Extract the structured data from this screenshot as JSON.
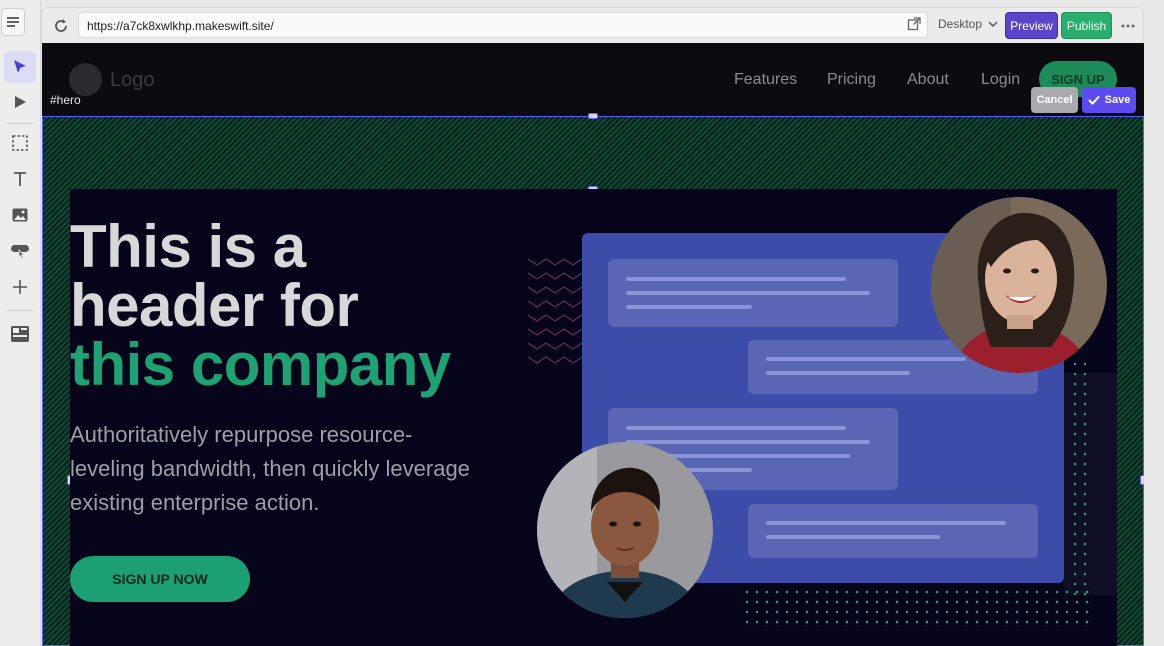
{
  "browser": {
    "url": "https://a7ck8xwlkhp.makeswift.site/",
    "device": "Desktop",
    "preview_label": "Preview",
    "publish_label": "Publish"
  },
  "tools": [
    "select-tool",
    "play-tool",
    "box-tool",
    "text-tool",
    "image-tool",
    "button-tool",
    "add-tool",
    "component-tool"
  ],
  "site": {
    "logo_text": "Logo",
    "nav": [
      {
        "label": "Features"
      },
      {
        "label": "Pricing"
      },
      {
        "label": "About"
      },
      {
        "label": "Login"
      }
    ],
    "nav_cta": "SIGN UP"
  },
  "editor": {
    "selected_id": "#hero",
    "cancel_label": "Cancel",
    "save_label": "Save"
  },
  "hero": {
    "line1": "This is a",
    "line2": "header for",
    "line3": "this company",
    "subtitle": "Authoritatively repurpose resource-leveling bandwidth, then quickly leverage existing enterprise action.",
    "cta": "SIGN UP NOW"
  },
  "colors": {
    "accent": "#1da273",
    "brand_purple": "#5b4bf0",
    "publish_green": "#2aae6e",
    "card_blue": "#3d4ca8"
  }
}
